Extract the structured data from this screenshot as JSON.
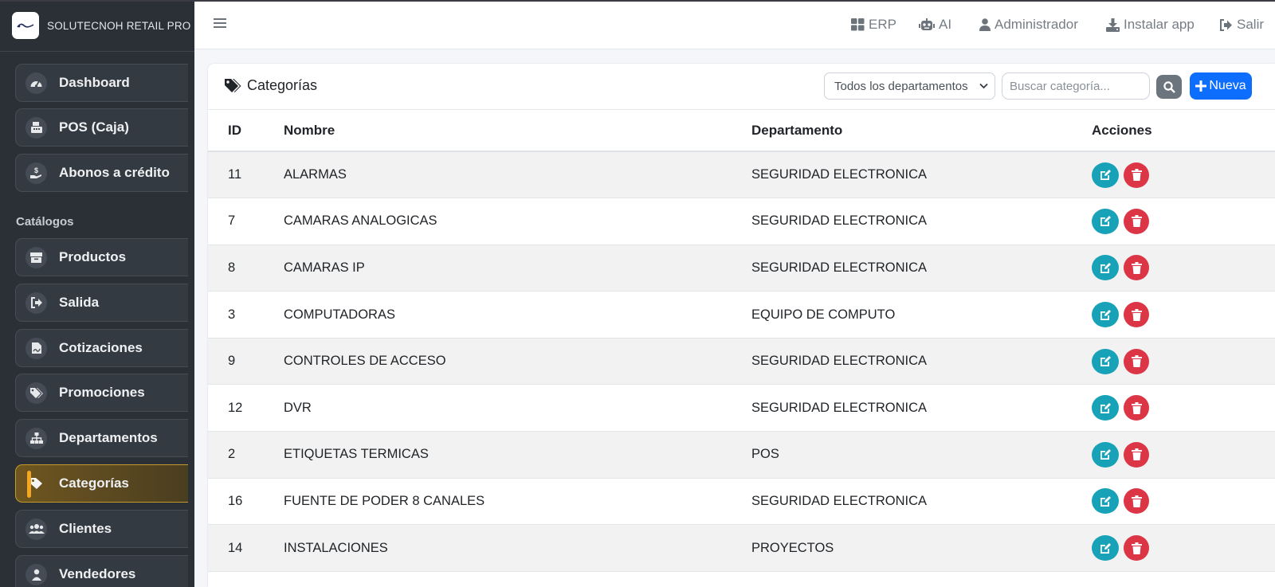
{
  "brand": {
    "name": "SOLUTECNOH RETAIL PRO"
  },
  "sidebar": {
    "section_label": "Catálogos",
    "items": [
      {
        "label": "Dashboard",
        "icon": "gauge-icon"
      },
      {
        "label": "POS (Caja)",
        "icon": "cash-register-icon"
      },
      {
        "label": "Abonos a crédito",
        "icon": "hand-money-icon"
      },
      {
        "label": "Productos",
        "icon": "box-icon"
      },
      {
        "label": "Salida",
        "icon": "exit-icon"
      },
      {
        "label": "Cotizaciones",
        "icon": "signature-icon"
      },
      {
        "label": "Promociones",
        "icon": "tags-icon"
      },
      {
        "label": "Departamentos",
        "icon": "sitemap-icon"
      },
      {
        "label": "Categorías",
        "icon": "tag-icon",
        "active": true
      },
      {
        "label": "Clientes",
        "icon": "users-icon"
      },
      {
        "label": "Vendedores",
        "icon": "user-icon"
      }
    ]
  },
  "topbar": {
    "links": [
      {
        "label": "ERP",
        "icon": "grid-icon"
      },
      {
        "label": "AI",
        "icon": "robot-icon"
      },
      {
        "label": "Administrador",
        "icon": "user-icon"
      },
      {
        "label": "Instalar app",
        "icon": "download-icon"
      },
      {
        "label": "Salir",
        "icon": "sign-out-icon"
      }
    ]
  },
  "page": {
    "title": "Categorías",
    "filter_selected": "Todos los departamentos",
    "search_placeholder": "Buscar categoría...",
    "new_label": "Nueva"
  },
  "table": {
    "columns": [
      "ID",
      "Nombre",
      "Departamento",
      "Acciones"
    ],
    "rows": [
      {
        "id": "11",
        "name": "ALARMAS",
        "dept": "SEGURIDAD ELECTRONICA"
      },
      {
        "id": "7",
        "name": "CAMARAS ANALOGICAS",
        "dept": "SEGURIDAD ELECTRONICA"
      },
      {
        "id": "8",
        "name": "CAMARAS IP",
        "dept": "SEGURIDAD ELECTRONICA"
      },
      {
        "id": "3",
        "name": "COMPUTADORAS",
        "dept": "EQUIPO DE COMPUTO"
      },
      {
        "id": "9",
        "name": "CONTROLES DE ACCESO",
        "dept": "SEGURIDAD ELECTRONICA"
      },
      {
        "id": "12",
        "name": "DVR",
        "dept": "SEGURIDAD ELECTRONICA"
      },
      {
        "id": "2",
        "name": "ETIQUETAS TERMICAS",
        "dept": "POS"
      },
      {
        "id": "16",
        "name": "FUENTE DE PODER 8 CANALES",
        "dept": "SEGURIDAD ELECTRONICA"
      },
      {
        "id": "14",
        "name": "INSTALACIONES",
        "dept": "PROYECTOS"
      }
    ]
  },
  "colors": {
    "sidebar_bg": "#2b3037",
    "active_accent": "#f5a623",
    "primary": "#0d6efd",
    "edit": "#17a2b8",
    "delete": "#dc3545"
  }
}
